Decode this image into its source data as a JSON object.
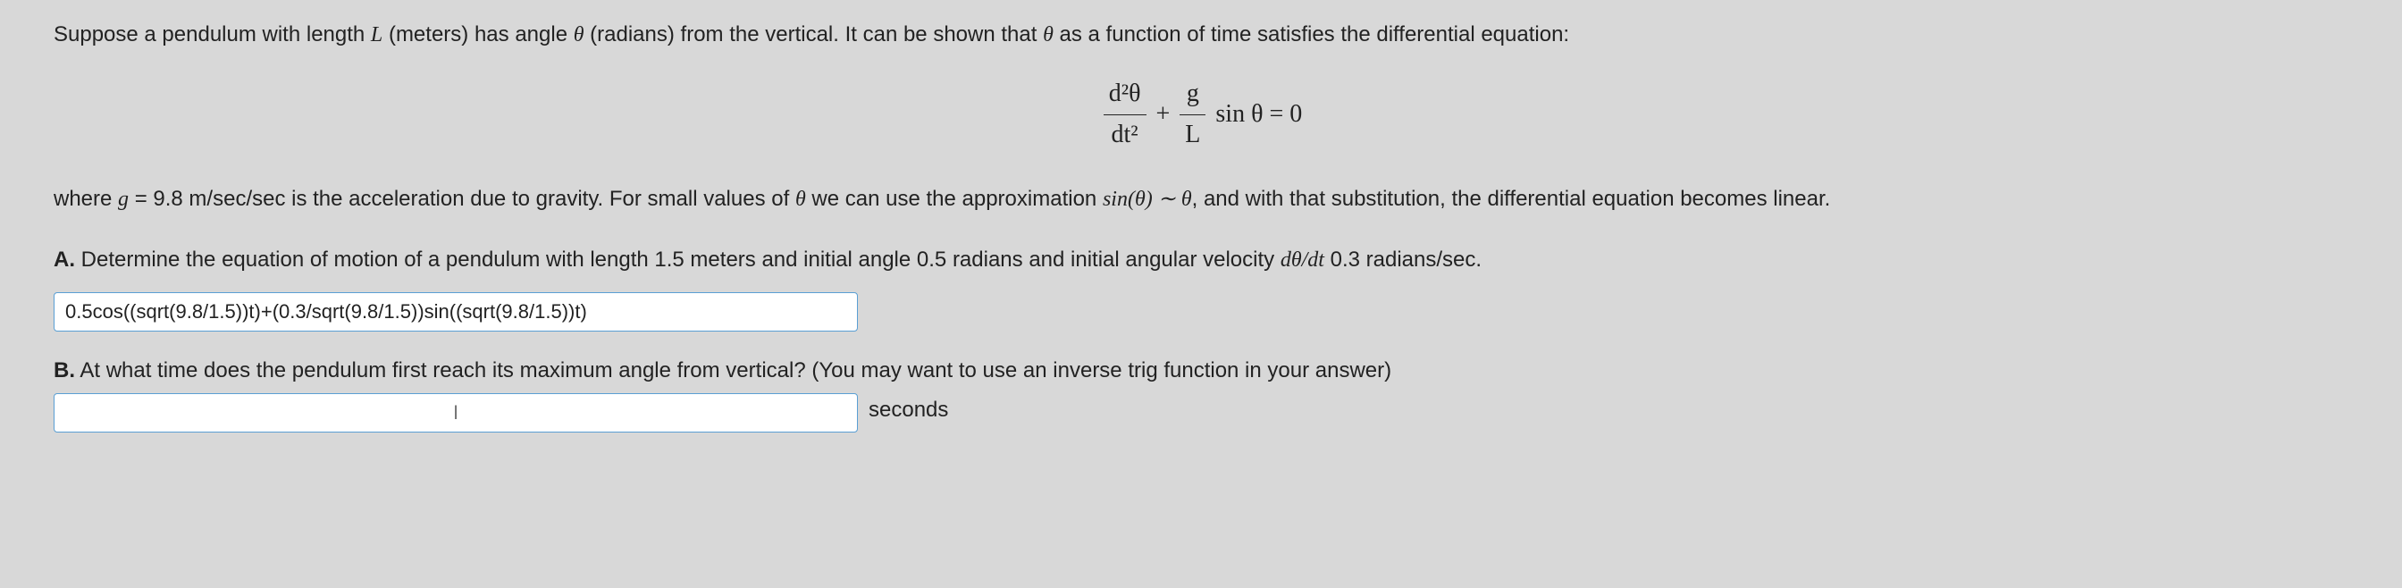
{
  "intro": {
    "prefix": "Suppose a pendulum with length ",
    "L": "L",
    "afterL": " (meters) has angle ",
    "theta": "θ",
    "afterTheta": " (radians) from the vertical. It can be shown that ",
    "theta2": "θ",
    "end": " as a function of time satisfies the differential equation:"
  },
  "equation": {
    "num1": "d²θ",
    "den1": "dt²",
    "plus": " + ",
    "num2": "g",
    "den2": "L",
    "sinPart": " sin θ = 0"
  },
  "where": {
    "prefix": "where ",
    "g": "g",
    "eqVal": " = 9.8",
    "units": " m/sec/sec is the acceleration due to gravity. For small values of ",
    "theta": "θ",
    "mid": " we can use the approximation ",
    "approx": "sin(θ) ∼ θ",
    "end": ", and with that substitution, the differential equation becomes linear."
  },
  "partA": {
    "label": "A.",
    "text": " Determine the equation of motion of a pendulum with length 1.5 meters and initial angle 0.5 radians and initial angular velocity ",
    "dtheta": "dθ/dt",
    "end": " 0.3 radians/sec.",
    "inputValue": "0.5cos((sqrt(9.8/1.5))t)+(0.3/sqrt(9.8/1.5))sin((sqrt(9.8/1.5))t)"
  },
  "partB": {
    "label": "B.",
    "text": " At what time does the pendulum first reach its maximum angle from vertical? (You may want to use an inverse trig function in your answer)",
    "inputPlaceholder": "I",
    "unitLabel": "seconds"
  }
}
